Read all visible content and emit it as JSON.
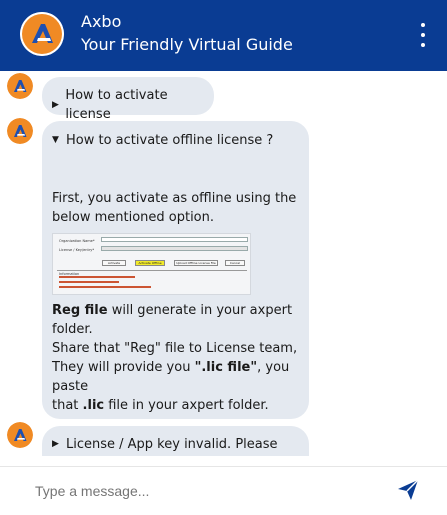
{
  "header": {
    "title": "Axbo",
    "subtitle": "Your Friendly Virtual Guide"
  },
  "messages": [
    {
      "heading": "How to activate license",
      "expanded": false
    },
    {
      "heading": "How to activate offline license ?",
      "expanded": true,
      "intro_line1": "First, you activate as offline using the",
      "intro_line2": "below mentioned option.",
      "reg_bold": "Reg file",
      "reg_rest": " will generate in your axpert",
      "reg_line2": "folder.",
      "share_line1": "Share that \"Reg\" file to License team,",
      "provide_start": "They will provide you ",
      "provide_bold": "\".lic file\"",
      "provide_end": ", you paste",
      "paste_start": "that ",
      "paste_bold": ".lic",
      "paste_end": " file in your axpert folder.",
      "screenshot": {
        "org_label": "Organization Name*",
        "key_label": "License / Key/entry*",
        "btn_activate": "Activate",
        "btn_offline": "Activate Offline",
        "btn_upload": "Upload Offline License File",
        "btn_cancel": "Cancel",
        "info_label": "Information"
      }
    },
    {
      "heading": "License / App key invalid. Please",
      "expanded": false
    }
  ],
  "composer": {
    "placeholder": "Type a message..."
  },
  "icons": {
    "logo": "axbo-logo-icon",
    "menu": "kebab-menu-icon",
    "send": "send-icon",
    "caret_right": "caret-right-icon",
    "caret_down": "caret-down-icon"
  },
  "colors": {
    "header_bg": "#0a3c93",
    "bubble_bg": "#e4e9f0",
    "logo_orange": "#f08a24",
    "send_blue": "#0a3c93"
  }
}
